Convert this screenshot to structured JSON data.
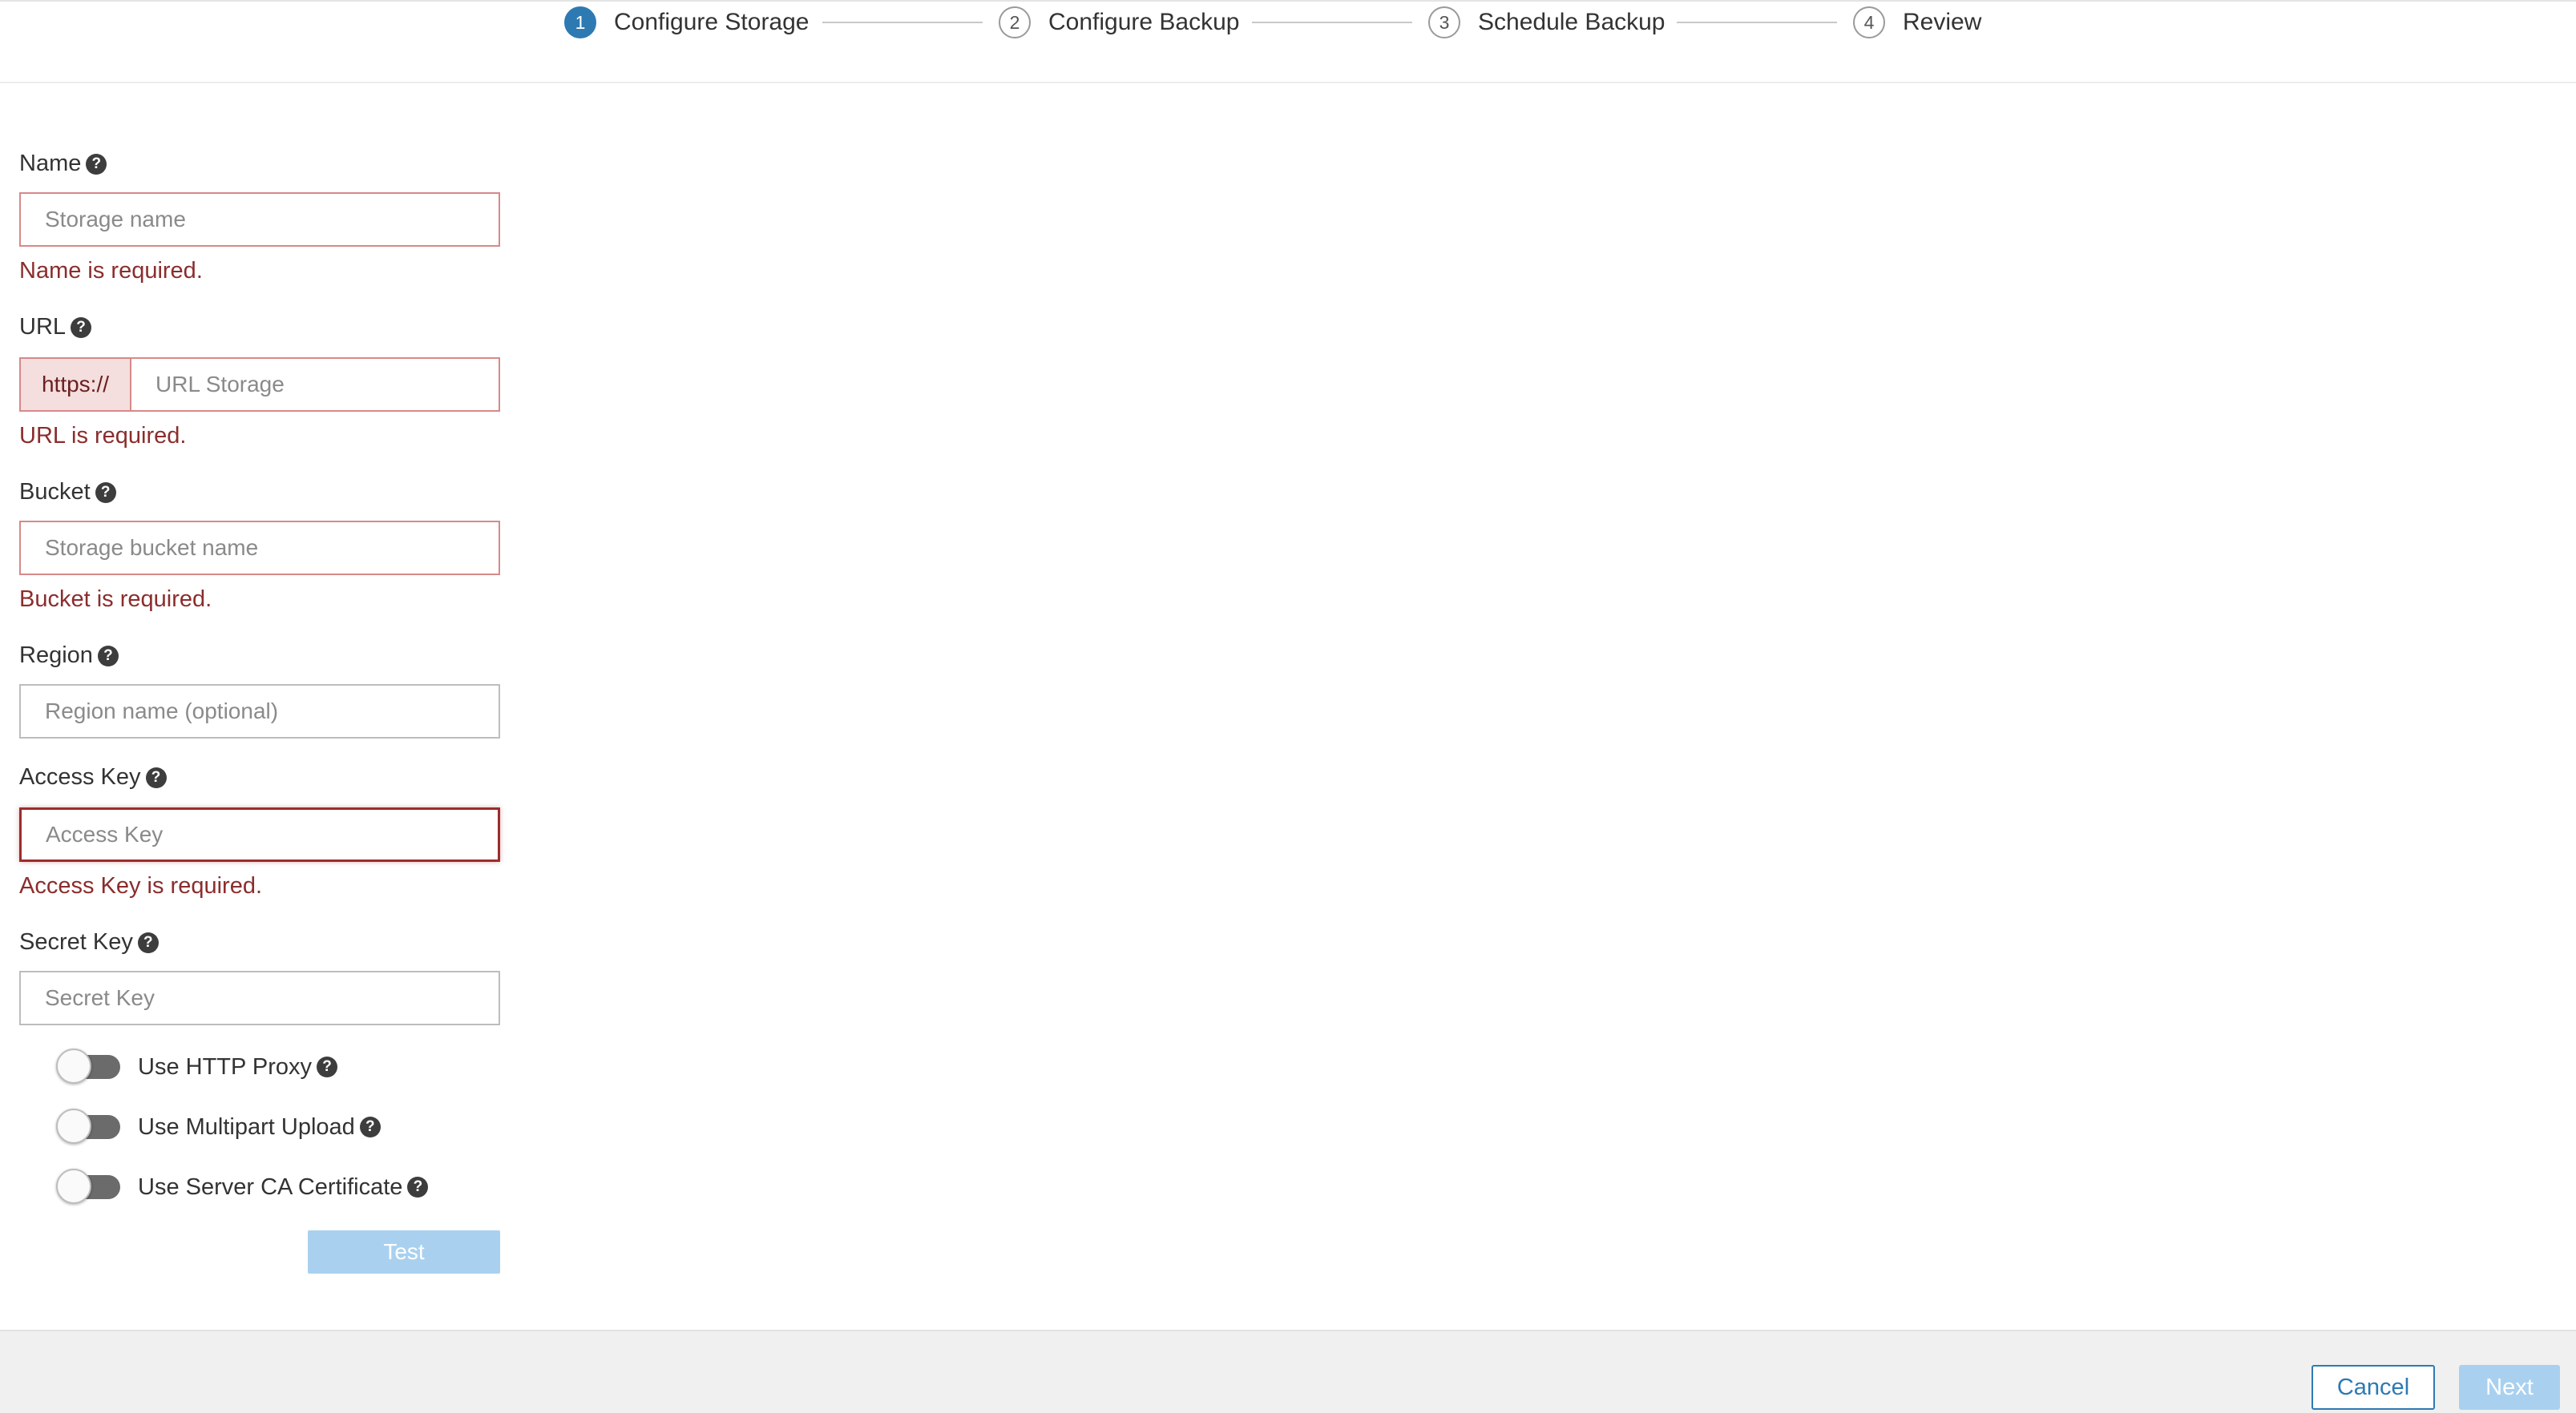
{
  "wizard": {
    "steps": [
      {
        "number": "1",
        "label": "Configure Storage"
      },
      {
        "number": "2",
        "label": "Configure Backup"
      },
      {
        "number": "3",
        "label": "Schedule Backup"
      },
      {
        "number": "4",
        "label": "Review"
      }
    ],
    "active_step": 1
  },
  "form": {
    "name": {
      "label": "Name",
      "placeholder": "Storage name",
      "value": "",
      "error": "Name is required."
    },
    "url": {
      "label": "URL",
      "prefix": "https://",
      "placeholder": "URL Storage",
      "value": "",
      "error": "URL is required."
    },
    "bucket": {
      "label": "Bucket",
      "placeholder": "Storage bucket name",
      "value": "",
      "error": "Bucket is required."
    },
    "region": {
      "label": "Region",
      "placeholder": "Region name (optional)",
      "value": ""
    },
    "access_key": {
      "label": "Access Key",
      "placeholder": "Access Key",
      "value": "",
      "error": "Access Key is required."
    },
    "secret_key": {
      "label": "Secret Key",
      "placeholder": "Secret Key",
      "value": ""
    },
    "help_glyph": "?"
  },
  "toggles": [
    {
      "label": "Use HTTP Proxy",
      "enabled": false
    },
    {
      "label": "Use Multipart Upload",
      "enabled": false
    },
    {
      "label": "Use Server CA Certificate",
      "enabled": false
    }
  ],
  "buttons": {
    "test": "Test",
    "cancel": "Cancel",
    "next": "Next"
  },
  "colors": {
    "accent": "#2d7ab3",
    "disabled_button": "#a9d1ef",
    "error_text": "#8b2d2d",
    "error_border": "#d78989"
  }
}
